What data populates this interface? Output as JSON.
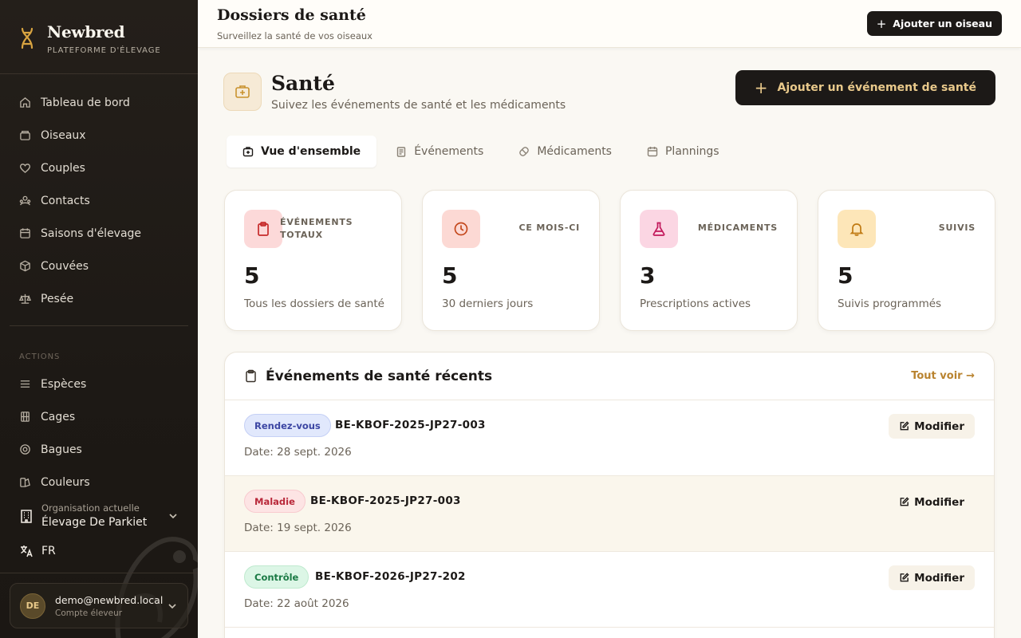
{
  "sidebar": {
    "brand": {
      "name": "Newbred",
      "subtitle": "PLATEFORME D'ÉLEVAGE"
    },
    "nav": [
      {
        "label": "Tableau de bord",
        "icon": "home-icon"
      },
      {
        "label": "Oiseaux",
        "icon": "bird-box-icon"
      },
      {
        "label": "Couples",
        "icon": "heart-icon"
      },
      {
        "label": "Contacts",
        "icon": "users-icon"
      },
      {
        "label": "Saisons d'élevage",
        "icon": "calendar-icon"
      },
      {
        "label": "Couvées",
        "icon": "egg-box-icon"
      },
      {
        "label": "Pesée",
        "icon": "scale-icon"
      }
    ],
    "actions_title": "ACTIONS",
    "actions": [
      {
        "label": "Espèces",
        "icon": "list-icon"
      },
      {
        "label": "Cages",
        "icon": "cage-icon"
      },
      {
        "label": "Bagues",
        "icon": "ring-icon"
      },
      {
        "label": "Couleurs",
        "icon": "palette-icon"
      }
    ],
    "org": {
      "label": "Organisation actuelle",
      "value": "Élevage De Parkiet"
    },
    "language": "FR",
    "user": {
      "initials": "DE",
      "email": "demo@newbred.local",
      "role": "Compte éleveur"
    }
  },
  "topbar": {
    "title": "Dossiers de santé",
    "subtitle": "Surveillez la santé de vos oiseaux",
    "add_bird": "Ajouter un oiseau"
  },
  "page": {
    "title": "Santé",
    "subtitle": "Suivez les événements de santé et les médicaments",
    "add_event": "Ajouter un événement de santé"
  },
  "tabs": [
    {
      "label": "Vue d'ensemble",
      "active": true
    },
    {
      "label": "Événements",
      "active": false
    },
    {
      "label": "Médicaments",
      "active": false
    },
    {
      "label": "Plannings",
      "active": false
    }
  ],
  "stats": [
    {
      "label": "ÉVÉNEMENTS TOTAUX",
      "value": "5",
      "desc": "Tous les dossiers de santé",
      "color": "#fcd9d9"
    },
    {
      "label": "CE MOIS-CI",
      "value": "5",
      "desc": "30 derniers jours",
      "color": "#fcd9d4"
    },
    {
      "label": "MÉDICAMENTS",
      "value": "3",
      "desc": "Prescriptions actives",
      "color": "#fbd6e3"
    },
    {
      "label": "SUIVIS",
      "value": "5",
      "desc": "Suivis programmés",
      "color": "#fde6b8"
    }
  ],
  "recent": {
    "title": "Événements de santé récents",
    "see_all": "Tout voir →",
    "edit_label": "Modifier",
    "events": [
      {
        "type": "Rendez-vous",
        "ring": "BE-KBOF-2025-JP27-003",
        "date": "Date: 28 sept. 2026"
      },
      {
        "type": "Maladie",
        "ring": "BE-KBOF-2025-JP27-003",
        "date": "Date: 19 sept. 2026"
      },
      {
        "type": "Contrôle",
        "ring": "BE-KBOF-2026-JP27-202",
        "date": "Date: 22 août 2026"
      }
    ]
  }
}
